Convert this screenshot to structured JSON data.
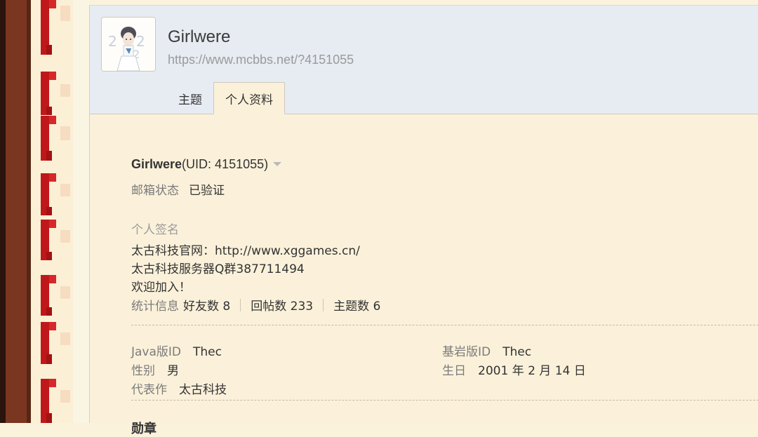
{
  "user": {
    "name": "Girlwere",
    "url": "https://www.mcbbs.net/?4151055",
    "uid_label": "(UID: 4151055)"
  },
  "tabs": [
    {
      "label": "主题"
    },
    {
      "label": "个人资料"
    }
  ],
  "profile": {
    "email_status_label": "邮箱状态",
    "email_status_value": "已验证",
    "signature_label": "个人签名",
    "signature_lines": [
      "太古科技官网：http://www.xggames.cn/",
      "太古科技服务器Q群387711494",
      "欢迎加入！"
    ],
    "stats_label": "统计信息",
    "stats": [
      {
        "label": "好友数",
        "value": "8"
      },
      {
        "label": "回帖数",
        "value": "233"
      },
      {
        "label": "主题数",
        "value": "6"
      }
    ],
    "fields_left": [
      {
        "label": "Java版ID",
        "value": "Thec"
      },
      {
        "label": "性别",
        "value": "男"
      },
      {
        "label": "代表作",
        "value": "太古科技"
      }
    ],
    "fields_right": [
      {
        "label": "基岩版ID",
        "value": "Thec"
      },
      {
        "label": "生日",
        "value": "2001 年 2 月 14 日"
      }
    ],
    "next_section": "勋章"
  },
  "avatar": {
    "icon": "user-avatar-2022-illustration"
  }
}
